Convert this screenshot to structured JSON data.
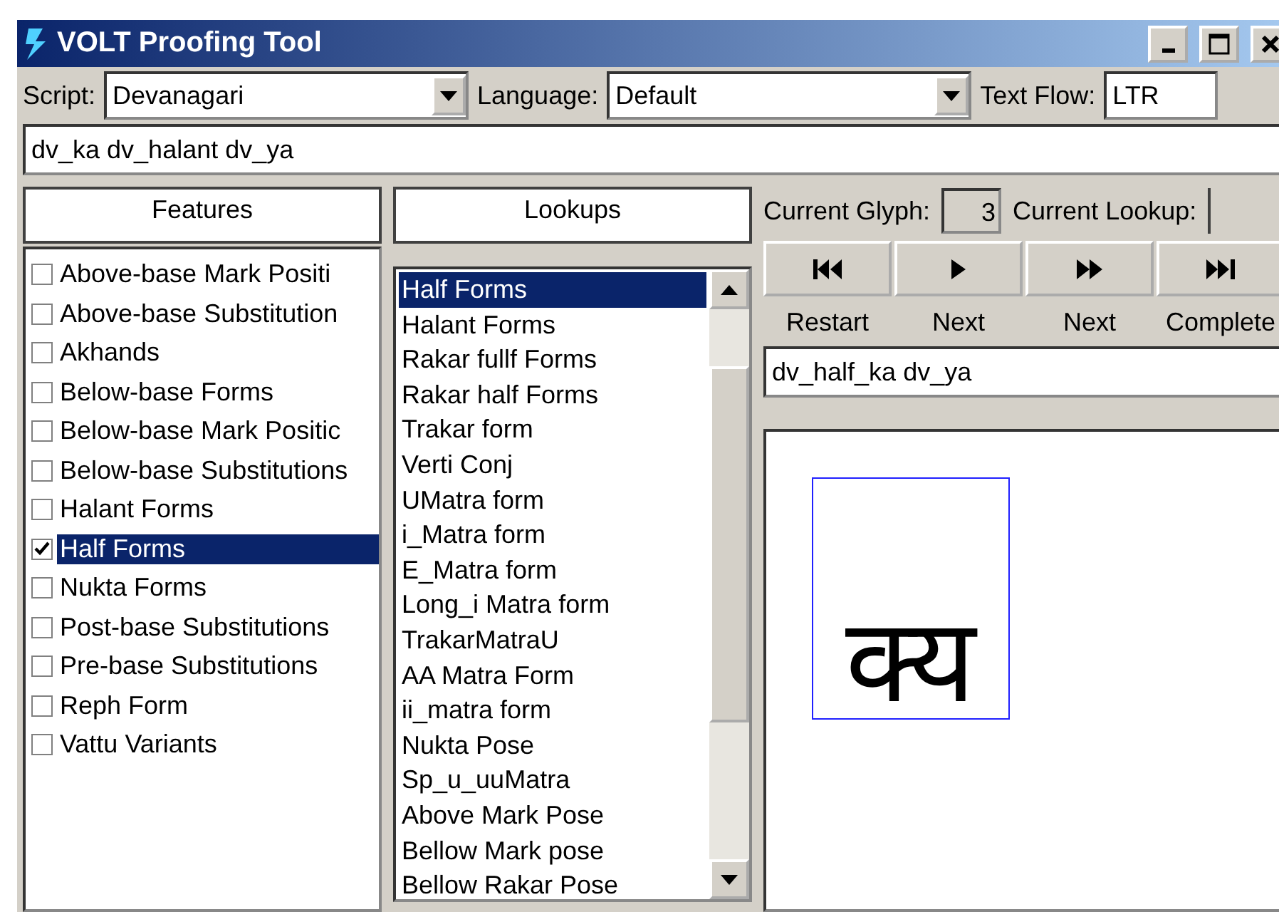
{
  "window": {
    "title": "VOLT Proofing Tool"
  },
  "toolbar": {
    "script_label": "Script:",
    "script_value": "Devanagari",
    "language_label": "Language:",
    "language_value": "Default",
    "text_flow_label": "Text Flow:",
    "text_flow_value": "LTR"
  },
  "input_text": "dv_ka dv_halant dv_ya",
  "features": {
    "header": "Features",
    "items": [
      {
        "label": "Above-base Mark Positi",
        "checked": false,
        "selected": false
      },
      {
        "label": "Above-base Substitution",
        "checked": false,
        "selected": false
      },
      {
        "label": "Akhands",
        "checked": false,
        "selected": false
      },
      {
        "label": "Below-base Forms",
        "checked": false,
        "selected": false
      },
      {
        "label": "Below-base Mark Positic",
        "checked": false,
        "selected": false
      },
      {
        "label": "Below-base Substitutions",
        "checked": false,
        "selected": false
      },
      {
        "label": "Halant Forms",
        "checked": false,
        "selected": false
      },
      {
        "label": "Half Forms",
        "checked": true,
        "selected": true
      },
      {
        "label": "Nukta Forms",
        "checked": false,
        "selected": false
      },
      {
        "label": "Post-base Substitutions",
        "checked": false,
        "selected": false
      },
      {
        "label": "Pre-base Substitutions",
        "checked": false,
        "selected": false
      },
      {
        "label": "Reph Form",
        "checked": false,
        "selected": false
      },
      {
        "label": "Vattu Variants",
        "checked": false,
        "selected": false
      }
    ]
  },
  "lookups": {
    "header": "Lookups",
    "items": [
      {
        "label": "Half Forms",
        "selected": true
      },
      {
        "label": "Halant Forms",
        "selected": false
      },
      {
        "label": "Rakar fullf Forms",
        "selected": false
      },
      {
        "label": "Rakar half Forms",
        "selected": false
      },
      {
        "label": "Trakar form",
        "selected": false
      },
      {
        "label": "Verti Conj",
        "selected": false
      },
      {
        "label": "UMatra form",
        "selected": false
      },
      {
        "label": "i_Matra form",
        "selected": false
      },
      {
        "label": "E_Matra form",
        "selected": false
      },
      {
        "label": "Long_i Matra form",
        "selected": false
      },
      {
        "label": "TrakarMatraU",
        "selected": false
      },
      {
        "label": "AA Matra Form",
        "selected": false
      },
      {
        "label": "ii_matra form",
        "selected": false
      },
      {
        "label": "Nukta Pose",
        "selected": false
      },
      {
        "label": "Sp_u_uuMatra",
        "selected": false
      },
      {
        "label": "Above Mark Pose",
        "selected": false
      },
      {
        "label": "Bellow Mark pose",
        "selected": false
      },
      {
        "label": "Bellow Rakar Pose",
        "selected": false
      }
    ]
  },
  "proof": {
    "current_glyph_label": "Current Glyph:",
    "current_glyph_value": "3",
    "current_lookup_label": "Current Lookup:",
    "controls": [
      {
        "kind": "restart",
        "label": "Restart"
      },
      {
        "kind": "next_glyph",
        "label": "Next"
      },
      {
        "kind": "next_lookup",
        "label": "Next"
      },
      {
        "kind": "complete",
        "label": "Complete"
      }
    ],
    "output_text": "dv_half_ka dv_ya",
    "glyph": "क्य"
  }
}
